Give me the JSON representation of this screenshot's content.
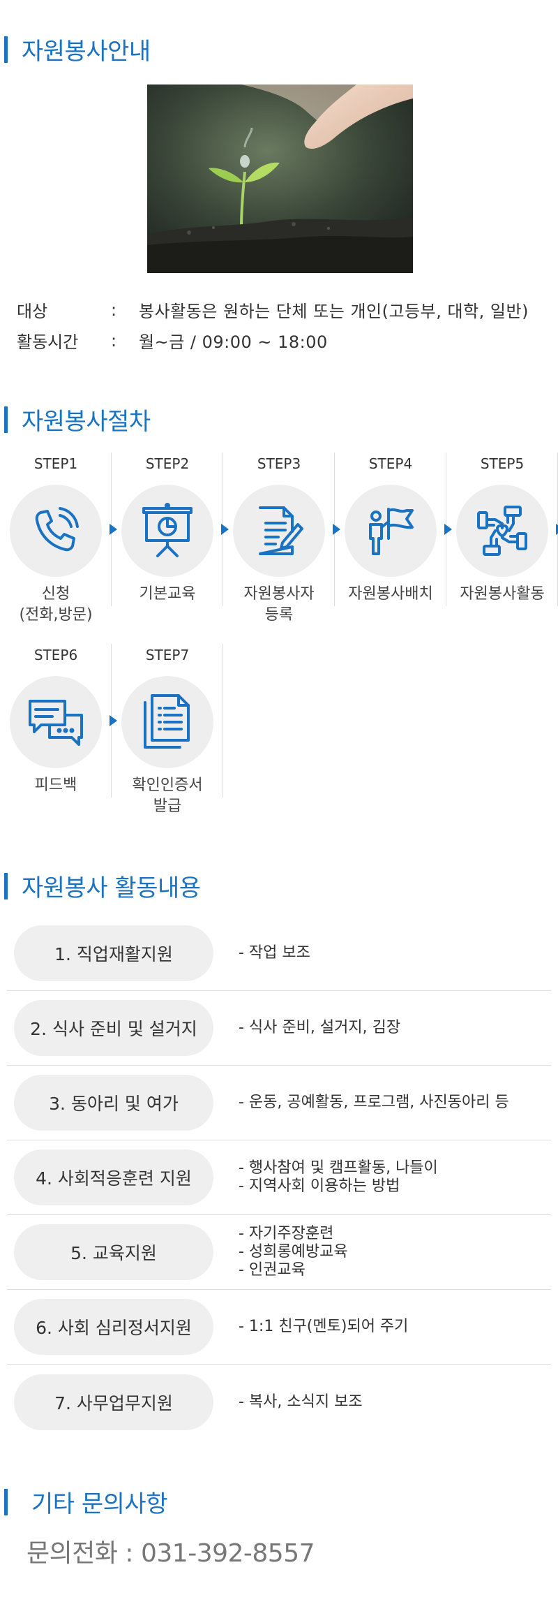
{
  "intro": {
    "title": "자원봉사안내",
    "rows": [
      {
        "key": "대상",
        "colon": ":",
        "value": "봉사활동은 원하는 단체 또는 개인(고등부, 대학, 일반)"
      },
      {
        "key": "활동시간",
        "colon": ":",
        "value": "월~금 / 09:00 ~ 18:00"
      }
    ]
  },
  "procedure": {
    "title": "자원봉사절차",
    "steps": [
      {
        "label": "STEP1",
        "name": "신청\n(전화,방문)",
        "icon": "phone-icon"
      },
      {
        "label": "STEP2",
        "name": "기본교육",
        "icon": "presentation-icon"
      },
      {
        "label": "STEP3",
        "name": "자원봉사자\n등록",
        "icon": "document-pen-icon"
      },
      {
        "label": "STEP4",
        "name": "자원봉사배치",
        "icon": "person-flag-icon"
      },
      {
        "label": "STEP5",
        "name": "자원봉사활동",
        "icon": "hands-heart-icon"
      },
      {
        "label": "STEP6",
        "name": "피드백",
        "icon": "chat-bubbles-icon"
      },
      {
        "label": "STEP7",
        "name": "확인인증서\n발급",
        "icon": "certificate-docs-icon"
      }
    ]
  },
  "activities": {
    "title": "자원봉사 활동내용",
    "items": [
      {
        "name": "1. 직업재활지원",
        "desc": [
          "- 작업 보조"
        ]
      },
      {
        "name": "2. 식사 준비 및 설거지",
        "desc": [
          "- 식사 준비, 설거지, 김장"
        ]
      },
      {
        "name": "3. 동아리 및 여가",
        "desc": [
          "- 운동, 공예활동, 프로그램, 사진동아리 등"
        ]
      },
      {
        "name": "4. 사회적응훈련 지원",
        "desc": [
          "- 행사참여 및 캠프활동, 나들이",
          "- 지역사회 이용하는 방법"
        ]
      },
      {
        "name": "5. 교육지원",
        "desc": [
          "- 자기주장훈련",
          "- 성희롱예방교육",
          "- 인권교육"
        ]
      },
      {
        "name": "6. 사회 심리정서지원",
        "desc": [
          "- 1:1 친구(멘토)되어 주기"
        ]
      },
      {
        "name": "7. 사무업무지원",
        "desc": [
          "- 복사, 소식지 보조"
        ]
      }
    ]
  },
  "contact": {
    "title": "기타 문의사항",
    "text": "문의전화 : 031-392-8557"
  },
  "colors": {
    "accent": "#1a72c2",
    "pill_bg": "#efefef",
    "circle_bg": "#eeeeee"
  }
}
